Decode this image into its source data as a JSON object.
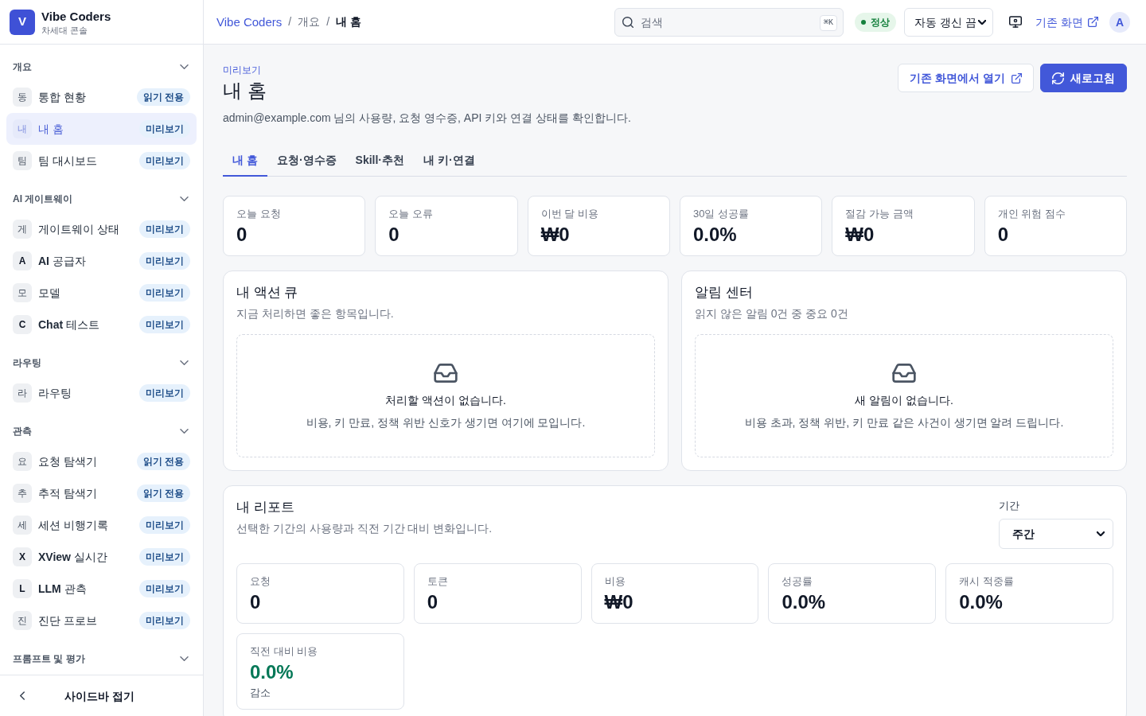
{
  "sidebar": {
    "logo": {
      "letter": "V",
      "name": "Vibe Coders",
      "tagline": "차세대 콘솔"
    },
    "sections": [
      {
        "title": "개요",
        "expanded": true,
        "items": [
          {
            "initial": "동",
            "initial_bold": false,
            "label": "통합 현황",
            "badge": "읽기 전용",
            "selected": false
          },
          {
            "initial": "내",
            "initial_bold": false,
            "label": "내 홈",
            "badge": "미리보기",
            "selected": true
          },
          {
            "initial": "팀",
            "initial_bold": false,
            "label": "팀 대시보드",
            "badge": "미리보기",
            "selected": false
          }
        ]
      },
      {
        "title": "AI 게이트웨이",
        "expanded": true,
        "items": [
          {
            "initial": "게",
            "initial_bold": false,
            "label": "게이트웨이 상태",
            "badge": "미리보기",
            "selected": false
          },
          {
            "initial": "A",
            "initial_bold": true,
            "label": "**AI** 공급자",
            "badge": "미리보기",
            "selected": false
          },
          {
            "initial": "모",
            "initial_bold": false,
            "label": "모델",
            "badge": "미리보기",
            "selected": false
          },
          {
            "initial": "C",
            "initial_bold": true,
            "label": "**Chat** 테스트",
            "badge": "미리보기",
            "selected": false
          }
        ]
      },
      {
        "title": "라우팅",
        "expanded": true,
        "items": [
          {
            "initial": "라",
            "initial_bold": false,
            "label": "라우팅",
            "badge": "미리보기",
            "selected": false
          }
        ]
      },
      {
        "title": "관측",
        "expanded": true,
        "items": [
          {
            "initial": "요",
            "initial_bold": false,
            "label": "요청 탐색기",
            "badge": "읽기 전용",
            "selected": false
          },
          {
            "initial": "추",
            "initial_bold": false,
            "label": "추적 탐색기",
            "badge": "읽기 전용",
            "selected": false
          },
          {
            "initial": "세",
            "initial_bold": false,
            "label": "세션 비행기록",
            "badge": "미리보기",
            "selected": false
          },
          {
            "initial": "X",
            "initial_bold": true,
            "label": "**XView** 실시간",
            "badge": "미리보기",
            "selected": false
          },
          {
            "initial": "L",
            "initial_bold": true,
            "label": "**LLM** 관측",
            "badge": "미리보기",
            "selected": false
          },
          {
            "initial": "진",
            "initial_bold": false,
            "label": "진단 프로브",
            "badge": "미리보기",
            "selected": false
          }
        ]
      },
      {
        "title": "프롬프트 및 평가",
        "expanded": true
      }
    ],
    "collapse_button": {
      "label": "사이드바 접기"
    }
  },
  "topbar": {
    "breadcrumbs": [
      {
        "kind": "link",
        "label": "Vibe Coders"
      },
      {
        "kind": "separator",
        "label": "/"
      },
      {
        "kind": "text",
        "label": "개요"
      },
      {
        "kind": "separator",
        "label": "/"
      },
      {
        "kind": "current",
        "label": "내 홈"
      }
    ],
    "search": {
      "placeholder": "검색",
      "shortcut": "⌘K"
    },
    "status": {
      "kind": "ok",
      "label": "정상"
    },
    "auto_refresh": {
      "value": "자동 갱신 끔"
    },
    "legacy_link": {
      "label": "기존 화면"
    },
    "avatar": {
      "initial": "A"
    }
  },
  "header": {
    "eyebrow": "미리보기",
    "title": "내 홈",
    "description": "admin@example.com 님의 사용량, 요청 영수증, API 키와 연결 상태를 확인합니다.",
    "actions": [
      {
        "kind": "secondary",
        "label": "기존 화면에서 열기"
      },
      {
        "kind": "primary",
        "label": "새로고침"
      }
    ]
  },
  "tabs": [
    {
      "label": "내 홈",
      "selected": true
    },
    {
      "label": "요청·영수증",
      "selected": false
    },
    {
      "label": "Skill·추천",
      "selected": false
    },
    {
      "label": "내 키·연결",
      "selected": false
    }
  ],
  "stats": [
    {
      "label": "오늘 요청",
      "value": "0"
    },
    {
      "label": "오늘 오류",
      "value": "0"
    },
    {
      "label": "이번 달 비용",
      "value": "₩0"
    },
    {
      "label": "30일 성공률",
      "value": "0.0%"
    },
    {
      "label": "절감 가능 금액",
      "value": "₩0"
    },
    {
      "label": "개인 위험 점수",
      "value": "0"
    }
  ],
  "panels": [
    {
      "title": "내 액션 큐",
      "subtitle": "지금 처리하면 좋은 항목입니다.",
      "empty_title": "처리할 액션이 없습니다.",
      "empty_text": "비용, 키 만료, 정책 위반 신호가 생기면 여기에 모입니다."
    },
    {
      "title": "알림 센터",
      "subtitle": "읽지 않은 알림 0건 중 중요 0건",
      "empty_title": "새 알림이 없습니다.",
      "empty_text": "비용 초과, 정책 위반, 키 만료 같은 사건이 생기면 알려 드립니다."
    }
  ],
  "report": {
    "title": "내 리포트",
    "subtitle": "선택한 기간의 사용량과 직전 기간 대비 변화입니다.",
    "period_label": "기간",
    "period_value": "주간",
    "metrics": [
      {
        "kind": "value",
        "label": "요청",
        "value": "0"
      },
      {
        "kind": "value",
        "label": "토큰",
        "value": "0"
      },
      {
        "kind": "value",
        "label": "비용",
        "value": "₩0"
      },
      {
        "kind": "value",
        "label": "성공률",
        "value": "0.0%"
      },
      {
        "kind": "value",
        "label": "캐시 적중률",
        "value": "0.0%"
      },
      {
        "kind": "change",
        "label": "직전 대비 비용",
        "value": "0.0%",
        "note": "감소"
      }
    ]
  }
}
